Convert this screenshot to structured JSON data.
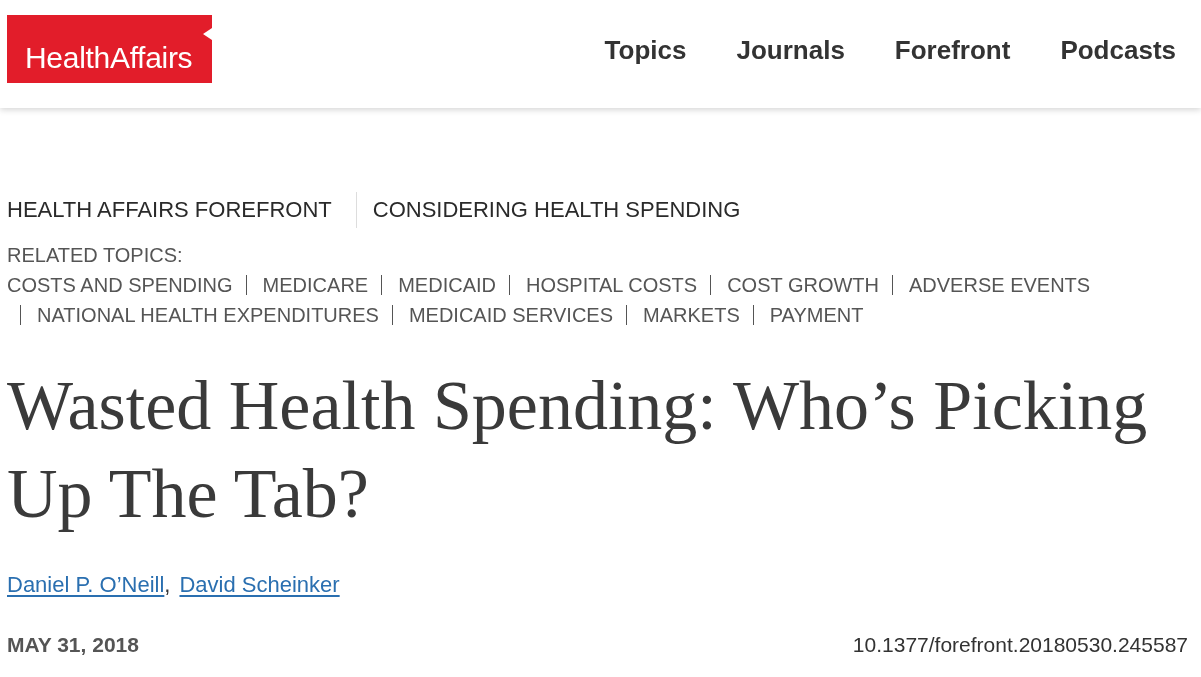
{
  "header": {
    "logo": "HealthAffairs",
    "nav": [
      "Topics",
      "Journals",
      "Forefront",
      "Podcasts"
    ]
  },
  "article": {
    "breadcrumb": [
      "HEALTH AFFAIRS FOREFRONT",
      "CONSIDERING HEALTH SPENDING"
    ],
    "related_topics_label": "RELATED TOPICS:",
    "related_topics": [
      "COSTS AND SPENDING",
      "MEDICARE",
      "MEDICAID",
      "HOSPITAL COSTS",
      "COST GROWTH",
      "ADVERSE EVENTS",
      "NATIONAL HEALTH EXPENDITURES",
      "MEDICAID SERVICES",
      "MARKETS",
      "PAYMENT"
    ],
    "title": "Wasted Health Spending: Who’s Picking Up The Tab?",
    "authors": [
      {
        "name": "Daniel P. O’Neill",
        "separator": ","
      },
      {
        "name": "David Scheinker"
      }
    ],
    "date": "MAY 31, 2018",
    "doi": "10.1377/forefront.20180530.245587"
  }
}
